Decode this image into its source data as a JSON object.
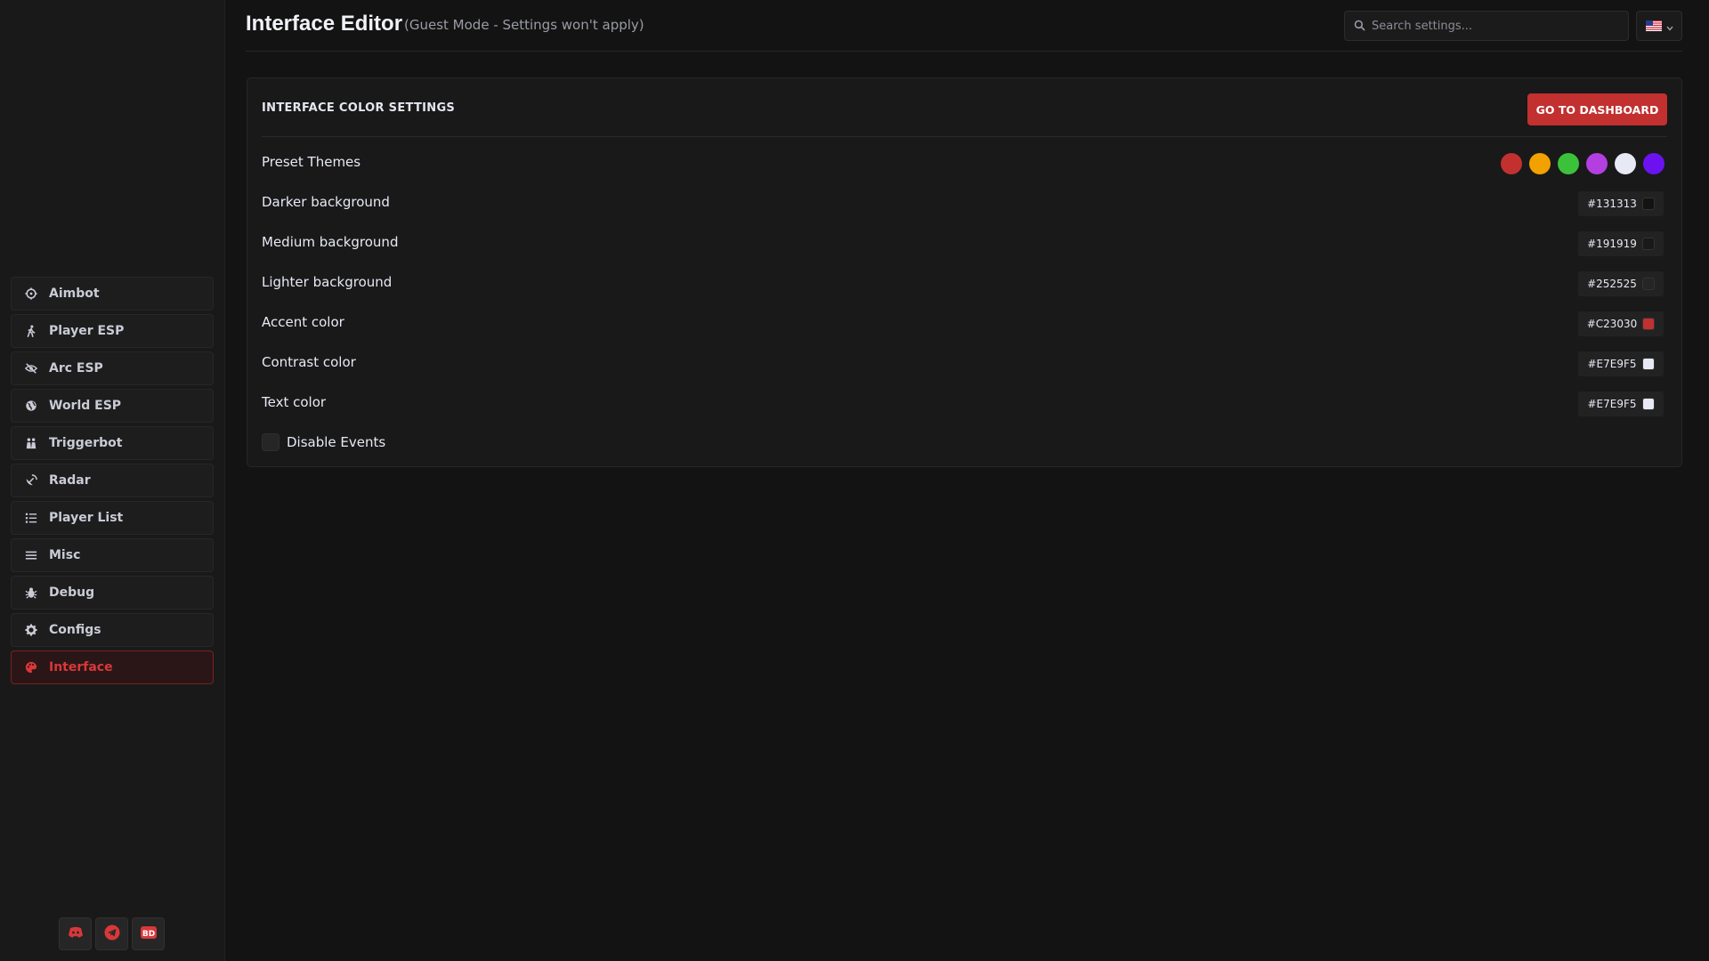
{
  "sidebar": {
    "items": [
      {
        "label": "Aimbot",
        "icon": "crosshair-icon"
      },
      {
        "label": "Player ESP",
        "icon": "walking-person-icon"
      },
      {
        "label": "Arc ESP",
        "icon": "eye-slash-icon"
      },
      {
        "label": "World ESP",
        "icon": "globe-icon"
      },
      {
        "label": "Triggerbot",
        "icon": "people-icon"
      },
      {
        "label": "Radar",
        "icon": "satellite-dish-icon"
      },
      {
        "label": "Player List",
        "icon": "list-icon"
      },
      {
        "label": "Misc",
        "icon": "menu-icon"
      },
      {
        "label": "Debug",
        "icon": "bug-icon"
      },
      {
        "label": "Configs",
        "icon": "gear-icon"
      },
      {
        "label": "Interface",
        "icon": "palette-icon",
        "active": true
      }
    ],
    "social": [
      {
        "icon": "discord-icon"
      },
      {
        "icon": "telegram-icon"
      },
      {
        "label": "BD",
        "icon": "bd-logo-icon"
      }
    ]
  },
  "header": {
    "title": "Interface Editor",
    "subtitle": "(Guest Mode - Settings won't apply)",
    "search_placeholder": "Search settings...",
    "language_icon": "us-flag-icon"
  },
  "card": {
    "title": "INTERFACE COLOR SETTINGS",
    "dashboard_button": "GO TO DASHBOARD",
    "preset_label": "Preset Themes",
    "presets": [
      "#C23030",
      "#F2A100",
      "#3CC23A",
      "#B43FE0",
      "#E7E9F5",
      "#6C12F0"
    ],
    "colors": [
      {
        "label": "Darker background",
        "value": "#131313",
        "swatch": "#131313"
      },
      {
        "label": "Medium background",
        "value": "#191919",
        "swatch": "#191919"
      },
      {
        "label": "Lighter background",
        "value": "#252525",
        "swatch": "#252525"
      },
      {
        "label": "Accent color",
        "value": "#C23030",
        "swatch": "#C23030"
      },
      {
        "label": "Contrast color",
        "value": "#E7E9F5",
        "swatch": "#E7E9F5"
      },
      {
        "label": "Text color",
        "value": "#E7E9F5",
        "swatch": "#E7E9F5"
      }
    ],
    "disable_events_label": "Disable Events"
  },
  "colors": {
    "accent": "#C23030",
    "bg_dark": "#131313",
    "bg_medium": "#191919",
    "text": "#E7E9F5"
  }
}
